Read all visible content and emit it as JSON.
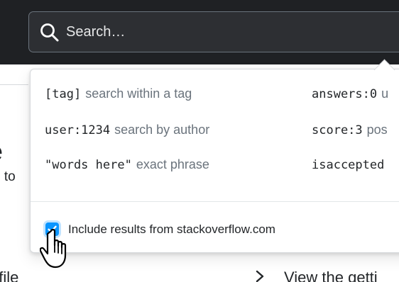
{
  "search": {
    "placeholder": "Search…"
  },
  "background": {
    "big_heading": "ne",
    "sub_text": "d to",
    "profile_text": "ofile",
    "getting_text": "View the getti"
  },
  "popover": {
    "hints_left": [
      {
        "code": "[tag]",
        "desc": "search within a tag"
      },
      {
        "code": "user:1234",
        "desc": "search by author"
      },
      {
        "code": "\"words here\"",
        "desc": "exact phrase"
      }
    ],
    "hints_right": [
      {
        "code": "answers:0",
        "desc": "u"
      },
      {
        "code": "score:3",
        "desc": "pos"
      },
      {
        "code": "isaccepted",
        "desc": ""
      }
    ],
    "checkbox": {
      "checked": true,
      "label": "Include results from stackoverflow.com"
    }
  },
  "colors": {
    "topbar": "#1f2124",
    "accent": "#0a95ff",
    "muted_text": "#6a737c",
    "text": "#232629"
  },
  "icons": {
    "search": "search-icon",
    "check": "check-icon",
    "chevron": "chevron-right-icon",
    "cursor": "hand-pointer-icon"
  }
}
